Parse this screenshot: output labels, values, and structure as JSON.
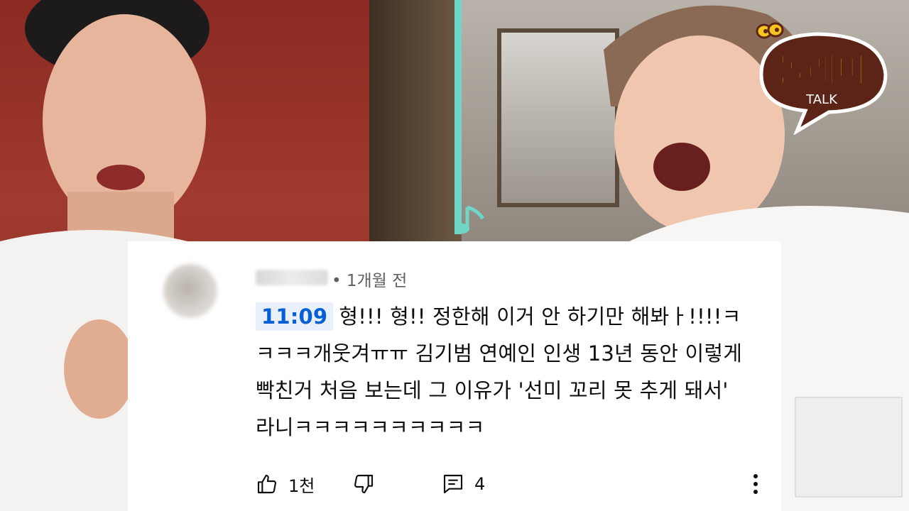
{
  "logo": {
    "brand_text": "놀래미",
    "sub_text": "TALK"
  },
  "comment": {
    "time_ago": "• 1개월 전",
    "timestamp": "11:09",
    "text": "형!!! 형!! 정한해 이거 안 하기만 해봐ㅏ!!!!ㅋㅋㅋㅋ개웃겨ㅠㅠ 김기범 연예인 인생 13년 동안 이렇게 빡친거 처음 보는데 그 이유가 '선미 꼬리 못 추게 돼서' 라니ㅋㅋㅋㅋㅋㅋㅋㅋㅋㅋ",
    "like_count": "1천",
    "reply_count": "4"
  },
  "icons": {
    "like": "thumbs-up-icon",
    "dislike": "thumbs-down-icon",
    "reply": "comment-icon",
    "menu": "more-vert-icon",
    "note": "music-note-icon"
  },
  "colors": {
    "timestamp_link": "#065fd4",
    "timestamp_bg": "#e9f0fb",
    "logo_fill": "#f7c51e",
    "logo_dark": "#5b2417"
  }
}
